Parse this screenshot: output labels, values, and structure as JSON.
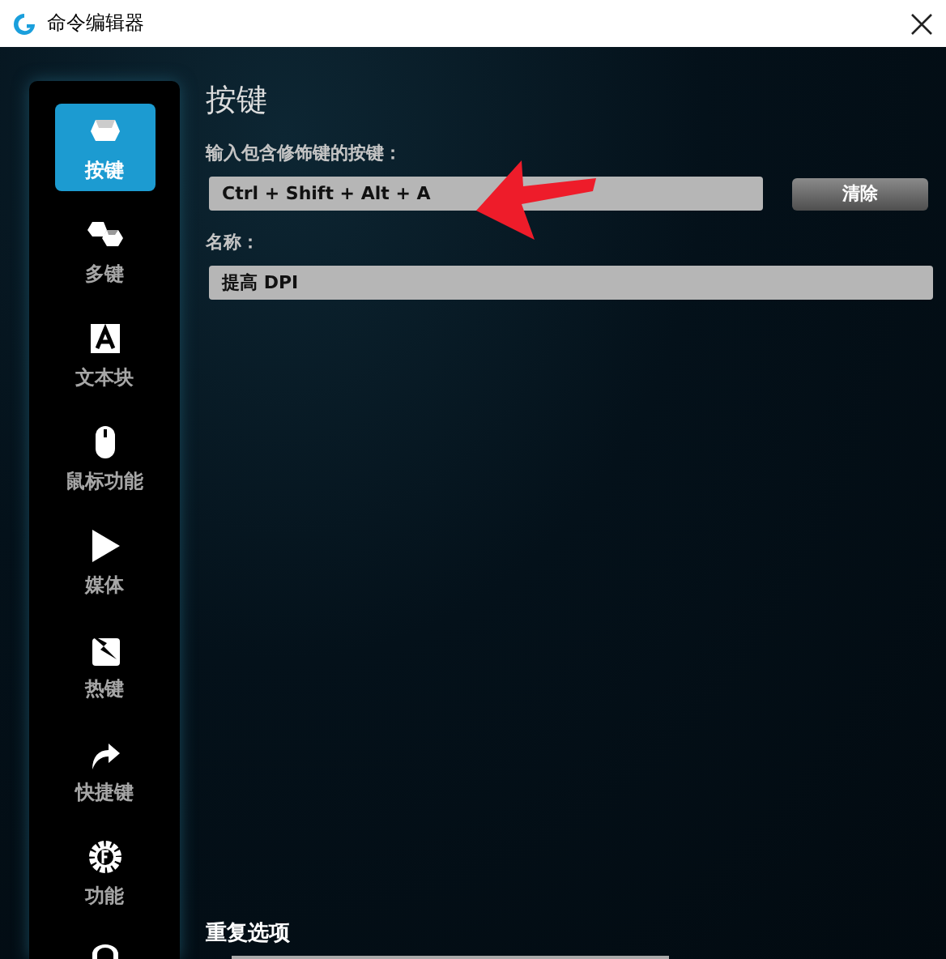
{
  "window": {
    "title": "命令编辑器"
  },
  "sidebar": {
    "items": [
      {
        "label": "按键",
        "selected": true
      },
      {
        "label": "多键",
        "selected": false
      },
      {
        "label": "文本块",
        "selected": false
      },
      {
        "label": "鼠标功能",
        "selected": false
      },
      {
        "label": "媒体",
        "selected": false
      },
      {
        "label": "热键",
        "selected": false
      },
      {
        "label": "快捷键",
        "selected": false
      },
      {
        "label": "功能",
        "selected": false
      }
    ]
  },
  "content": {
    "heading": "按键",
    "key_label": "输入包含修饰键的按键：",
    "key_field": {
      "value": "Ctrl + Shift + Alt + A"
    },
    "clear_button": "清除",
    "name_label": "名称：",
    "name_field": {
      "value": "提高 DPI"
    },
    "repeat_heading": "重复选项"
  }
}
